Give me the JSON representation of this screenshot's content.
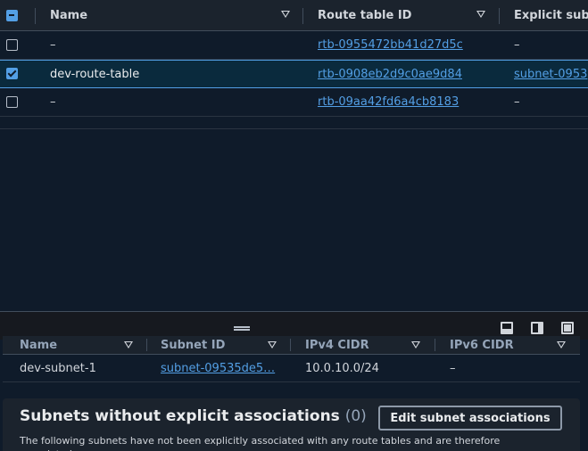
{
  "route_table": {
    "columns": [
      {
        "label": "Name"
      },
      {
        "label": "Route table ID"
      },
      {
        "label": "Explicit subn"
      }
    ],
    "rows": [
      {
        "name": "–",
        "route_table_id": "rtb-0955472bb41d27d5c",
        "explicit_subnet": "–",
        "selected": false
      },
      {
        "name": "dev-route-table",
        "route_table_id": "rtb-0908eb2d9c0ae9d84",
        "explicit_subnet": "subnet-0953",
        "selected": true
      },
      {
        "name": "–",
        "route_table_id": "rtb-09aa42fd6a4cb8183",
        "explicit_subnet": "–",
        "selected": false
      }
    ]
  },
  "subnet_table": {
    "columns": [
      {
        "label": "Name"
      },
      {
        "label": "Subnet ID"
      },
      {
        "label": "IPv4 CIDR"
      },
      {
        "label": "IPv6 CIDR"
      }
    ],
    "rows": [
      {
        "name": "dev-subnet-1",
        "subnet_id": "subnet-09535de5…",
        "ipv4": "10.0.10.0/24",
        "ipv6": "–"
      }
    ]
  },
  "without_assoc": {
    "title": "Subnets without explicit associations",
    "count": "(0)",
    "button_label": "Edit subnet associations",
    "description": "The following subnets have not been explicitly associated with any route tables and are therefore associated"
  },
  "colors": {
    "accent": "#539fe5",
    "background": "#0f1b2a",
    "header": "#1b232d"
  }
}
